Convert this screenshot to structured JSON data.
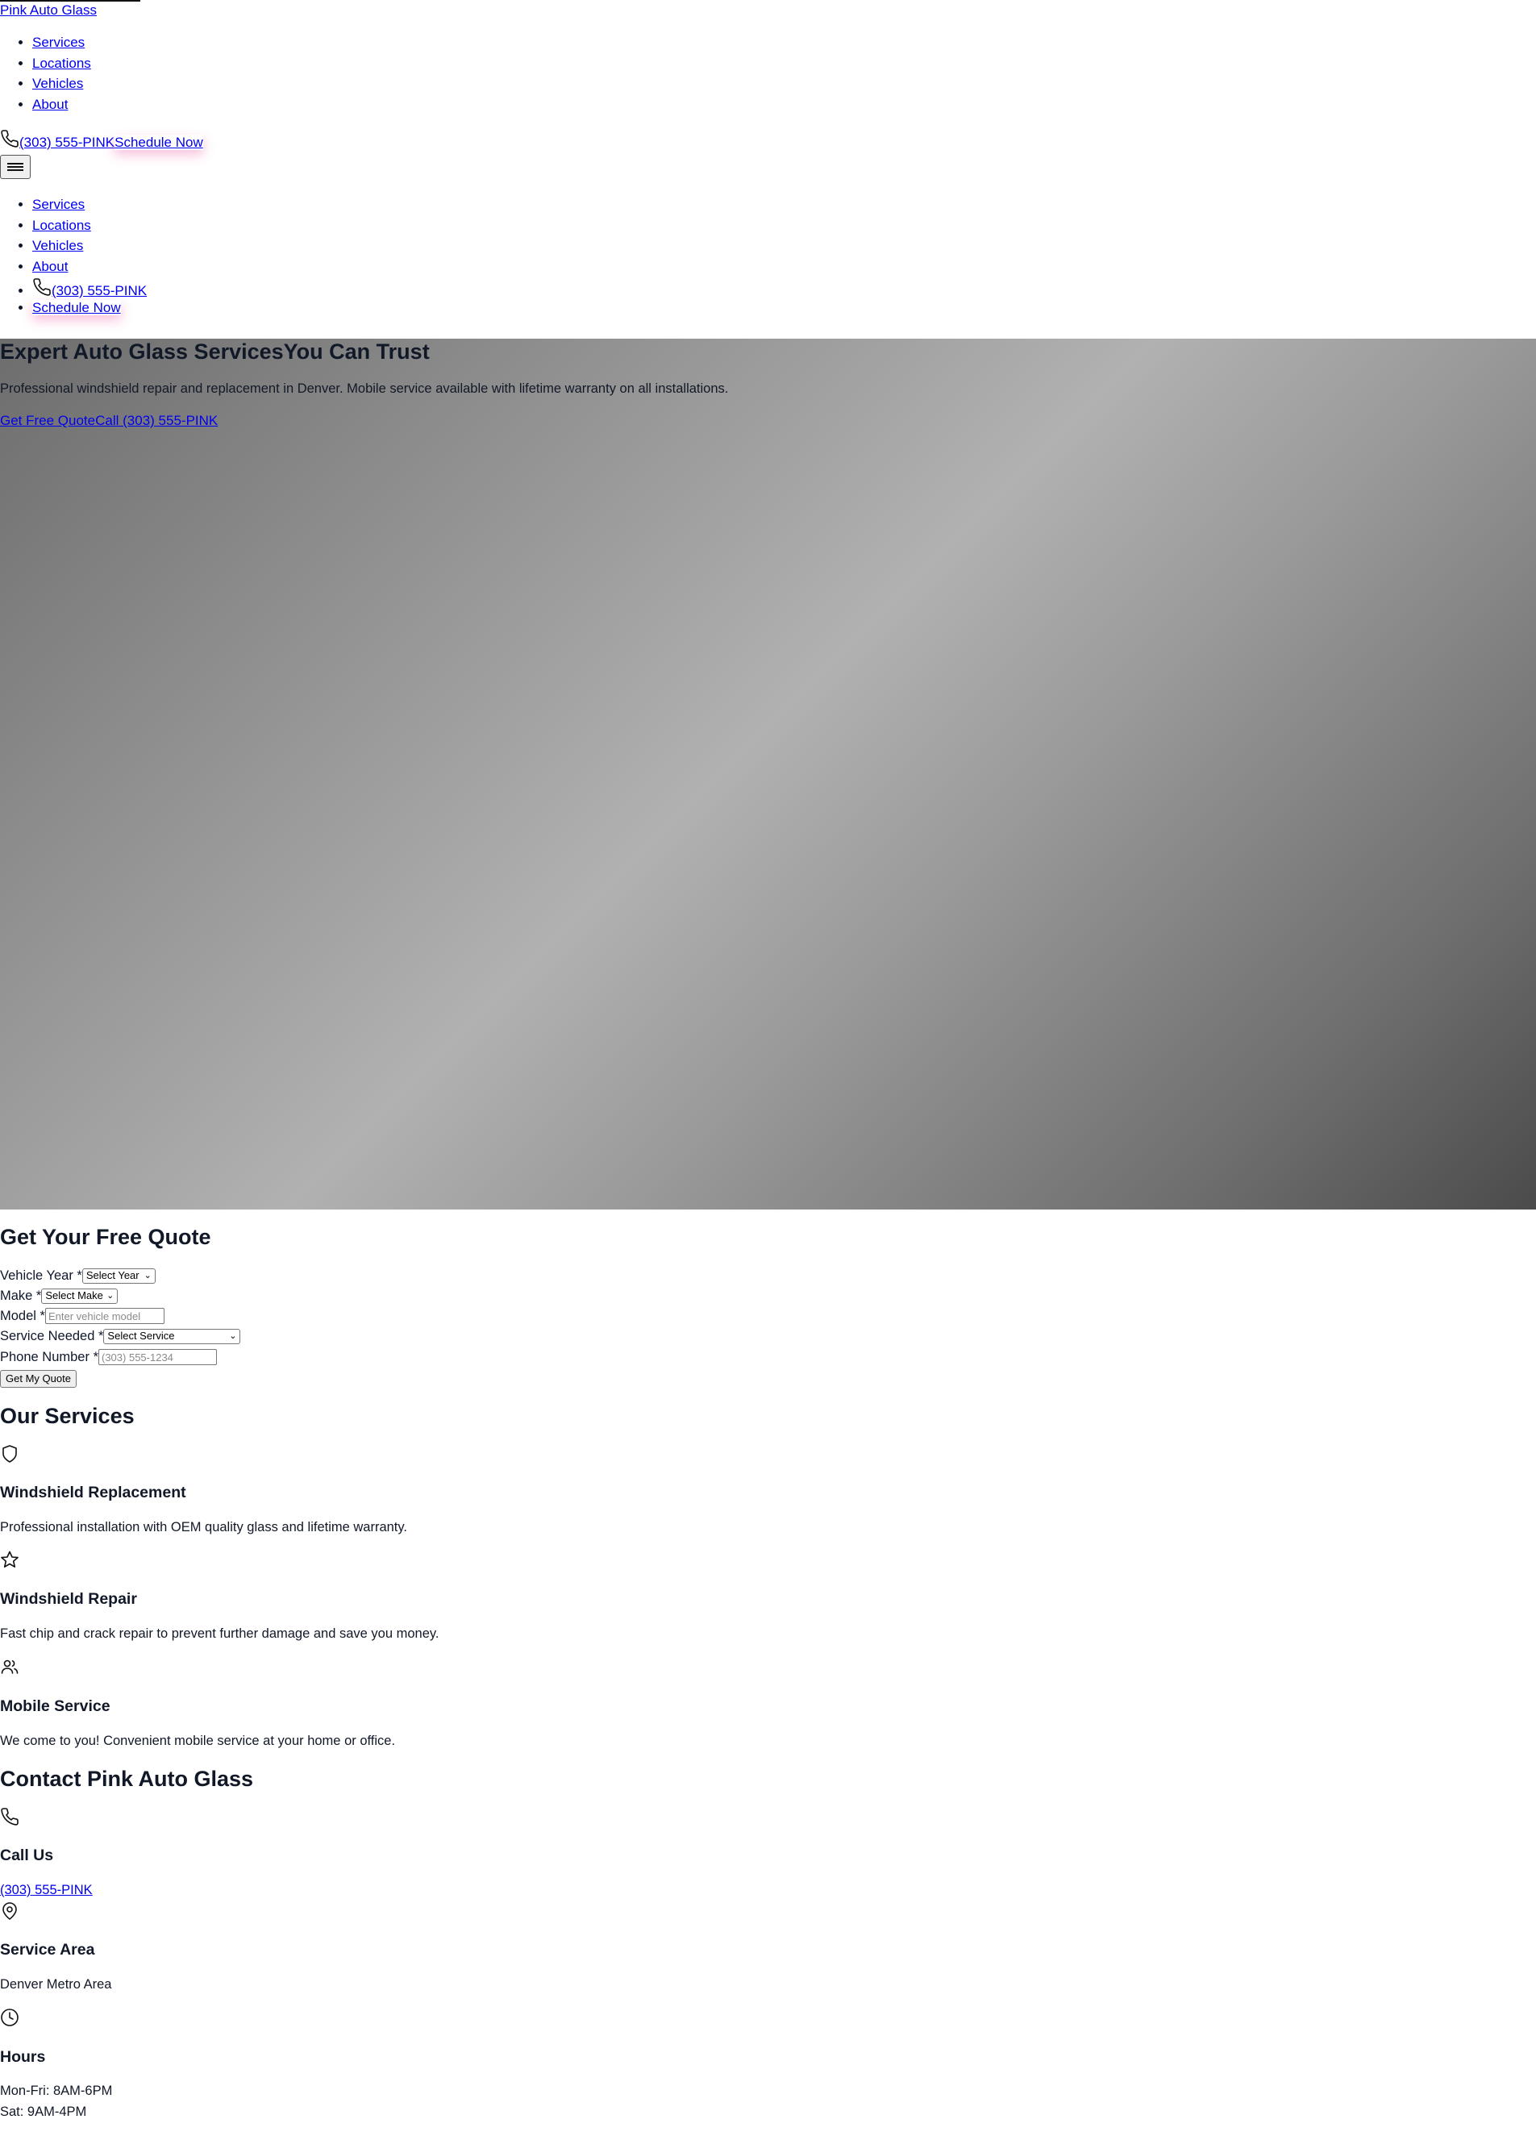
{
  "header": {
    "brand": "Pink Auto Glass",
    "nav": [
      "Services",
      "Locations",
      "Vehicles",
      "About"
    ],
    "phone": "(303) 555-PINK",
    "schedule": "Schedule Now",
    "menu_icon": "hamburger-icon"
  },
  "mobile_nav": {
    "items": [
      "Services",
      "Locations",
      "Vehicles",
      "About"
    ],
    "phone": "(303) 555-PINK",
    "schedule": "Schedule Now"
  },
  "hero": {
    "title_part1": "Expert Auto Glass Services",
    "title_part2": "You Can Trust",
    "subtitle": "Professional windshield repair and replacement in Denver. Mobile service available with lifetime warranty on all installations.",
    "cta_quote": "Get Free Quote",
    "cta_call": "Call (303) 555-PINK"
  },
  "quote_form": {
    "title": "Get Your Free Quote",
    "year_label": "Vehicle Year *",
    "year_value": "Select Year",
    "make_label": "Make *",
    "make_value": "Select Make",
    "model_label": "Model *",
    "model_placeholder": "Enter vehicle model",
    "service_label": "Service Needed *",
    "service_value": "Select Service",
    "phone_label": "Phone Number *",
    "phone_placeholder": "(303) 555-1234",
    "submit": "Get My Quote"
  },
  "services": {
    "title": "Our Services",
    "items": [
      {
        "icon": "shield-icon",
        "title": "Windshield Replacement",
        "text": "Professional installation with OEM quality glass and lifetime warranty."
      },
      {
        "icon": "star-icon",
        "title": "Windshield Repair",
        "text": "Fast chip and crack repair to prevent further damage and save you money."
      },
      {
        "icon": "users-icon",
        "title": "Mobile Service",
        "text": "We come to you! Convenient mobile service at your home or office."
      }
    ]
  },
  "contact": {
    "title": "Contact Pink Auto Glass",
    "call_title": "Call Us",
    "call_value": "(303) 555-PINK",
    "area_title": "Service Area",
    "area_value": "Denver Metro Area",
    "hours_title": "Hours",
    "hours_weekday": "Mon-Fri: 8AM-6PM",
    "hours_sat": "Sat: 9AM-4PM"
  },
  "colors": {
    "accent_shadow": "#ec4899",
    "link": "#0000ee",
    "heading": "#111827"
  }
}
